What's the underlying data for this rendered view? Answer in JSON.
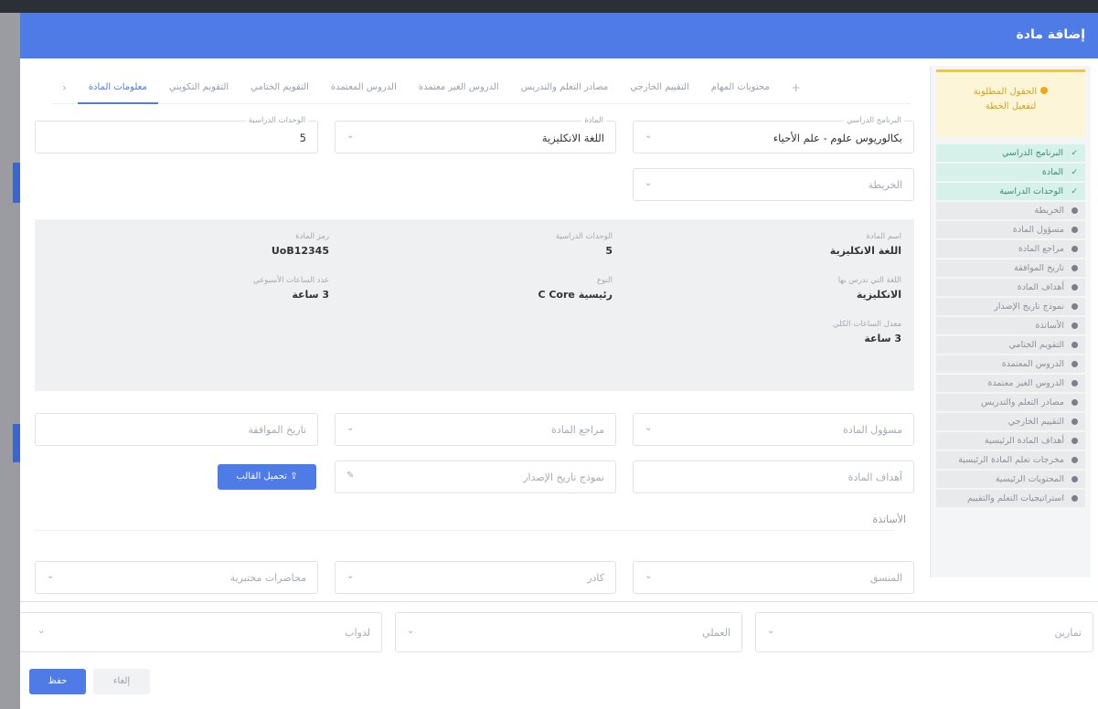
{
  "modal": {
    "title": "إضافة مادة"
  },
  "tabs": [
    "معلومات المادة",
    "التقويم التكويني",
    "التقويم الختامي",
    "الدروس المعتمدة",
    "الدروس الغير معتمدة",
    "مصادر التعلم والتدريس",
    "التقييم الخارجي",
    "محتويات المهام"
  ],
  "tab_arrows": {
    "right": "‹",
    "left": "+"
  },
  "alert": {
    "line1": "الحقول المطلوبة",
    "line2": "لتفعيل الخطة"
  },
  "steps": [
    {
      "label": "البرنامج الدراسي",
      "done": true
    },
    {
      "label": "المادة",
      "done": true
    },
    {
      "label": "الوحدات الدراسية",
      "done": true
    },
    {
      "label": "الخريطة",
      "done": false
    },
    {
      "label": "مسؤول المادة",
      "done": false
    },
    {
      "label": "مراجع المادة",
      "done": false
    },
    {
      "label": "تاريخ الموافقة",
      "done": false
    },
    {
      "label": "أهداف المادة",
      "done": false
    },
    {
      "label": "نموذج تاريخ الإصدار",
      "done": false
    },
    {
      "label": "الأساتذة",
      "done": false
    },
    {
      "label": "التقويم الختامي",
      "done": false
    },
    {
      "label": "الدروس المعتمدة",
      "done": false
    },
    {
      "label": "الدروس الغير معتمدة",
      "done": false
    },
    {
      "label": "مصادر التعلم والتدريس",
      "done": false
    },
    {
      "label": "التقييم الخارجي",
      "done": false
    },
    {
      "label": "أهداف المادة الرئيسية",
      "done": false
    },
    {
      "label": "مخرجات تعلم المادة الرئيسية",
      "done": false
    },
    {
      "label": "المحتويات الرئيسية",
      "done": false
    },
    {
      "label": "استراتيجيات التعلم والتقييم",
      "done": false
    }
  ],
  "step_check": "✓",
  "fields": {
    "program": {
      "label": "البرنامج الدراسي",
      "value": "بكالوريوس علوم - علم الأحياء"
    },
    "course": {
      "label": "المادة",
      "value": "اللغة الانكليزية"
    },
    "credits": {
      "label": "الوحدات الدراسية",
      "value": "5"
    },
    "map": {
      "placeholder": "الخريطة"
    },
    "owner": {
      "placeholder": "مسؤول المادة"
    },
    "references": {
      "placeholder": "مراجع المادة"
    },
    "approval_date": {
      "placeholder": "تاريخ الموافقة"
    },
    "goals": {
      "placeholder": "أهداف المادة"
    },
    "release_template": {
      "placeholder": "نموذج تاريخ الإصدار"
    },
    "coordinator": {
      "placeholder": "المنسق"
    },
    "teachers": {
      "placeholder": "كادر"
    },
    "lab_hours": {
      "placeholder": "محاضرات مختبرية"
    },
    "exercises": {
      "placeholder": "تمارين"
    },
    "practical": {
      "placeholder": "العملي"
    },
    "duties": {
      "placeholder": "لدواب"
    }
  },
  "info": {
    "course_name": {
      "label": "اسم المادة",
      "value": "اللغة الانكليزية"
    },
    "credit_units": {
      "label": "الوحدات الدراسية",
      "value": "5"
    },
    "course_code": {
      "label": "رمز المادة",
      "value": "UoB12345"
    },
    "taught_lang": {
      "label": "اللغة التي تدرس بها",
      "value": "الانكليزية"
    },
    "type": {
      "label": "النوع",
      "value": "رئيسية C Core"
    },
    "weekly_hours": {
      "label": "عدد الساعات الأسبوعي",
      "value": "3 ساعة"
    },
    "total_hours": {
      "label": "معدل الساعات الكلي",
      "value": "3 ساعة"
    }
  },
  "section_labels": {
    "teachers": "الأساتذة"
  },
  "buttons": {
    "upload_template": "تحميل القالب ⇪",
    "save": "حفظ",
    "cancel": "إلغاء"
  },
  "icons": {
    "chevron": "⌄",
    "attach": "✎"
  },
  "colors": {
    "primary": "#4f7be6",
    "done": "#d6f0ea",
    "warning": "#f0c541"
  }
}
